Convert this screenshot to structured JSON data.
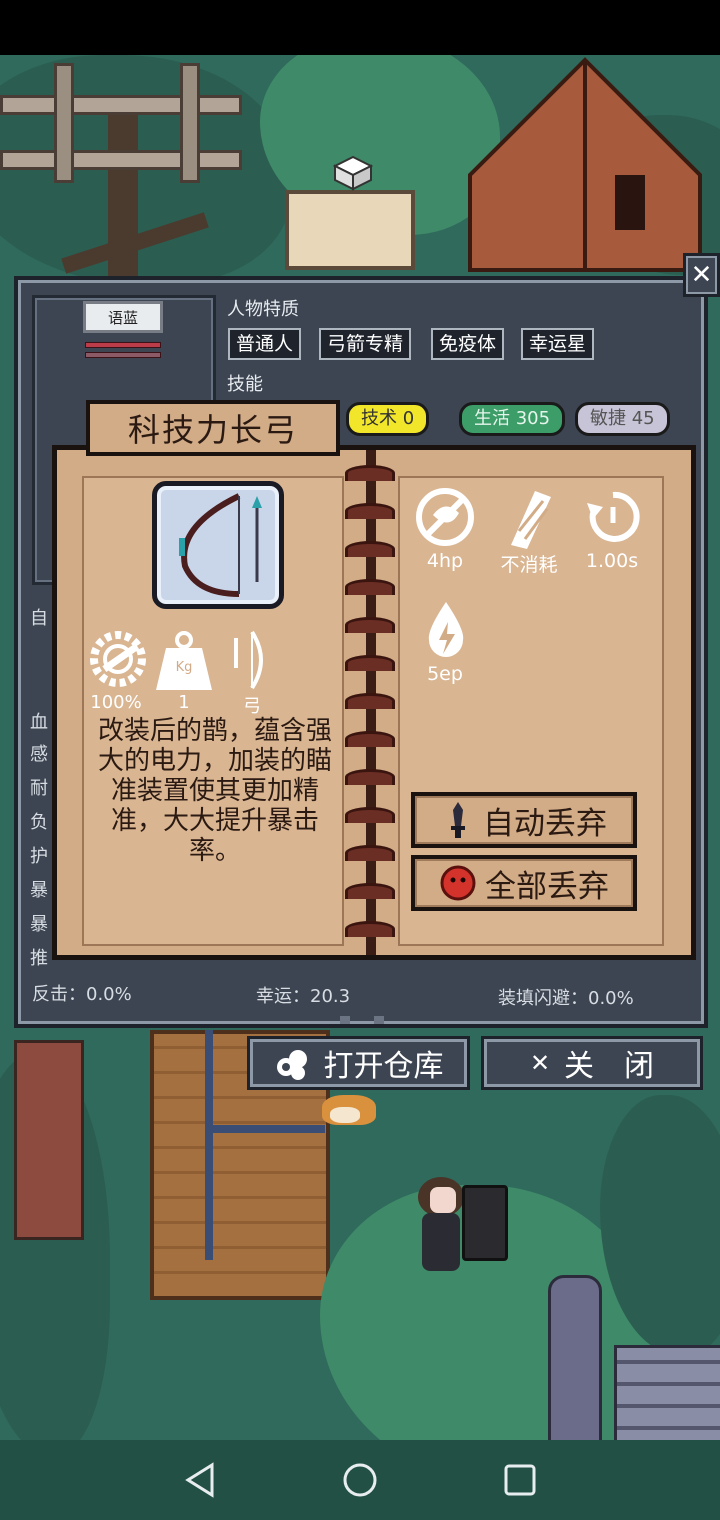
{
  "panel": {
    "character_name": "语蓝",
    "traits_label": "人物特质",
    "traits": [
      "普通人",
      "弓箭专精",
      "免疫体",
      "幸运星"
    ],
    "skills_label": "技能",
    "skill_tags": [
      {
        "label": "技术 0",
        "color": "#f2e62a"
      },
      {
        "label": "生活 305",
        "color": "#3c9d69"
      },
      {
        "label": "敏捷 45",
        "color": "#c8c4d8"
      }
    ],
    "side_stubs": [
      "自",
      "血",
      "感",
      "耐",
      "负",
      "护",
      "暴",
      "暴",
      "推"
    ],
    "stats_bottom": {
      "counter": "反击：0.0%",
      "luck": "幸运：20.3",
      "reload_dodge": "装填闪避：0.0%"
    },
    "close_icon": "close-icon"
  },
  "item": {
    "name": "科技力长弓",
    "durability": "100%",
    "weight": "1",
    "weight_icon_text": "Kg",
    "category": "弓",
    "description": "改装后的鹊，蕴含强大的电力，加装的瞄准装置使其更加精准，大大提升暴击率。",
    "props": {
      "hp_cost": "4hp",
      "ammo": "不消耗",
      "cooldown": "1.00s",
      "energy": "5ep"
    },
    "auto_discard_label": "自动丢弃",
    "discard_all_label": "全部丢弃"
  },
  "bottom_buttons": {
    "open_storage": "打开仓库",
    "close": "关　闭"
  }
}
